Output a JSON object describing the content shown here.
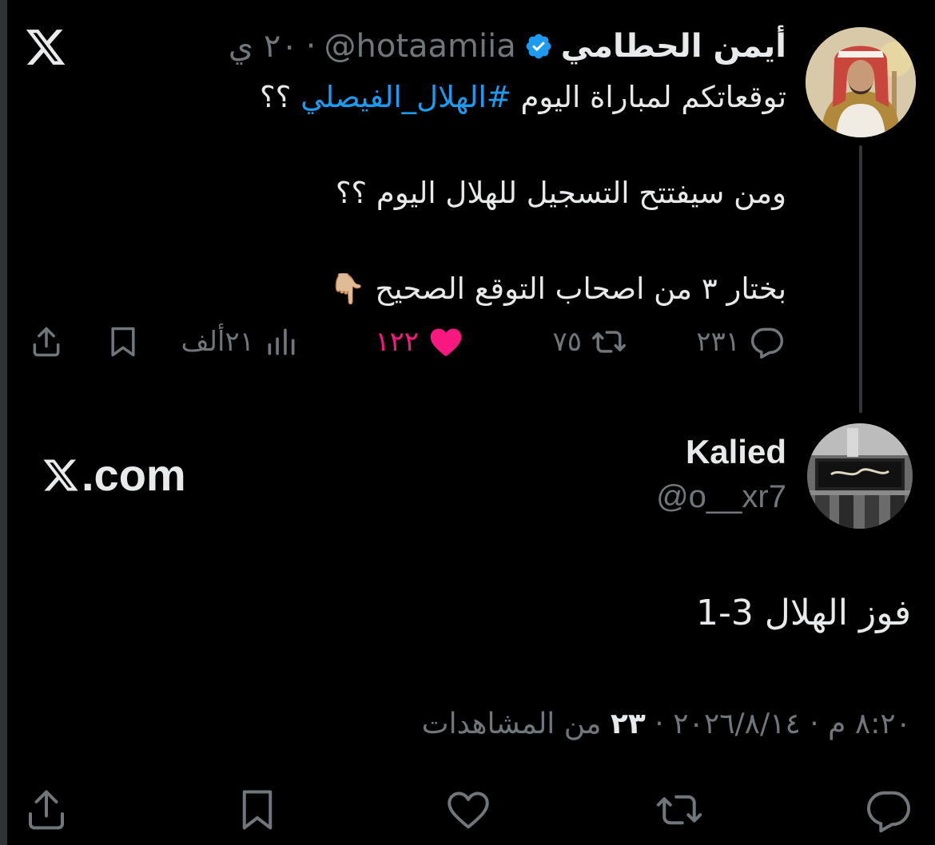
{
  "colors": {
    "background": "#000000",
    "text": "#e7e9ea",
    "muted": "#71767b",
    "link": "#1d9bf0",
    "like": "#f91880",
    "verified": "#1d9bf0"
  },
  "logo": {
    "icon": "x-logo-icon"
  },
  "parent_tweet": {
    "author_name": "أيمن الحطامي",
    "verified": true,
    "handle": "@hotaamiia",
    "separator": "·",
    "time": "٢٠ ي",
    "text_line1_before": "توقعاتكم لمباراة اليوم ",
    "text_hashtag": "#الهلال_الفيصلي",
    "text_line1_after": " ؟؟",
    "text_line2": "ومن سيفتتح التسجيل للهلال اليوم ؟؟",
    "text_line3": "بختار ٣ من اصحاب التوقع الصحيح 👇🏼",
    "actions": {
      "replies": "٢٣١",
      "reposts": "٧٥",
      "likes": "١٢٢",
      "views": "٢١ألف"
    }
  },
  "reply_tweet": {
    "author_name": "Kalied",
    "handle": "@o__xr7",
    "watermark": ".com",
    "text": "فوز الهلال 3-1",
    "meta_datetime": "٨:٢٠ م · ٢٠٢٦/٨/١٤ · ",
    "meta_views_count": "٢٣",
    "meta_views_label": " من المشاهدات"
  }
}
